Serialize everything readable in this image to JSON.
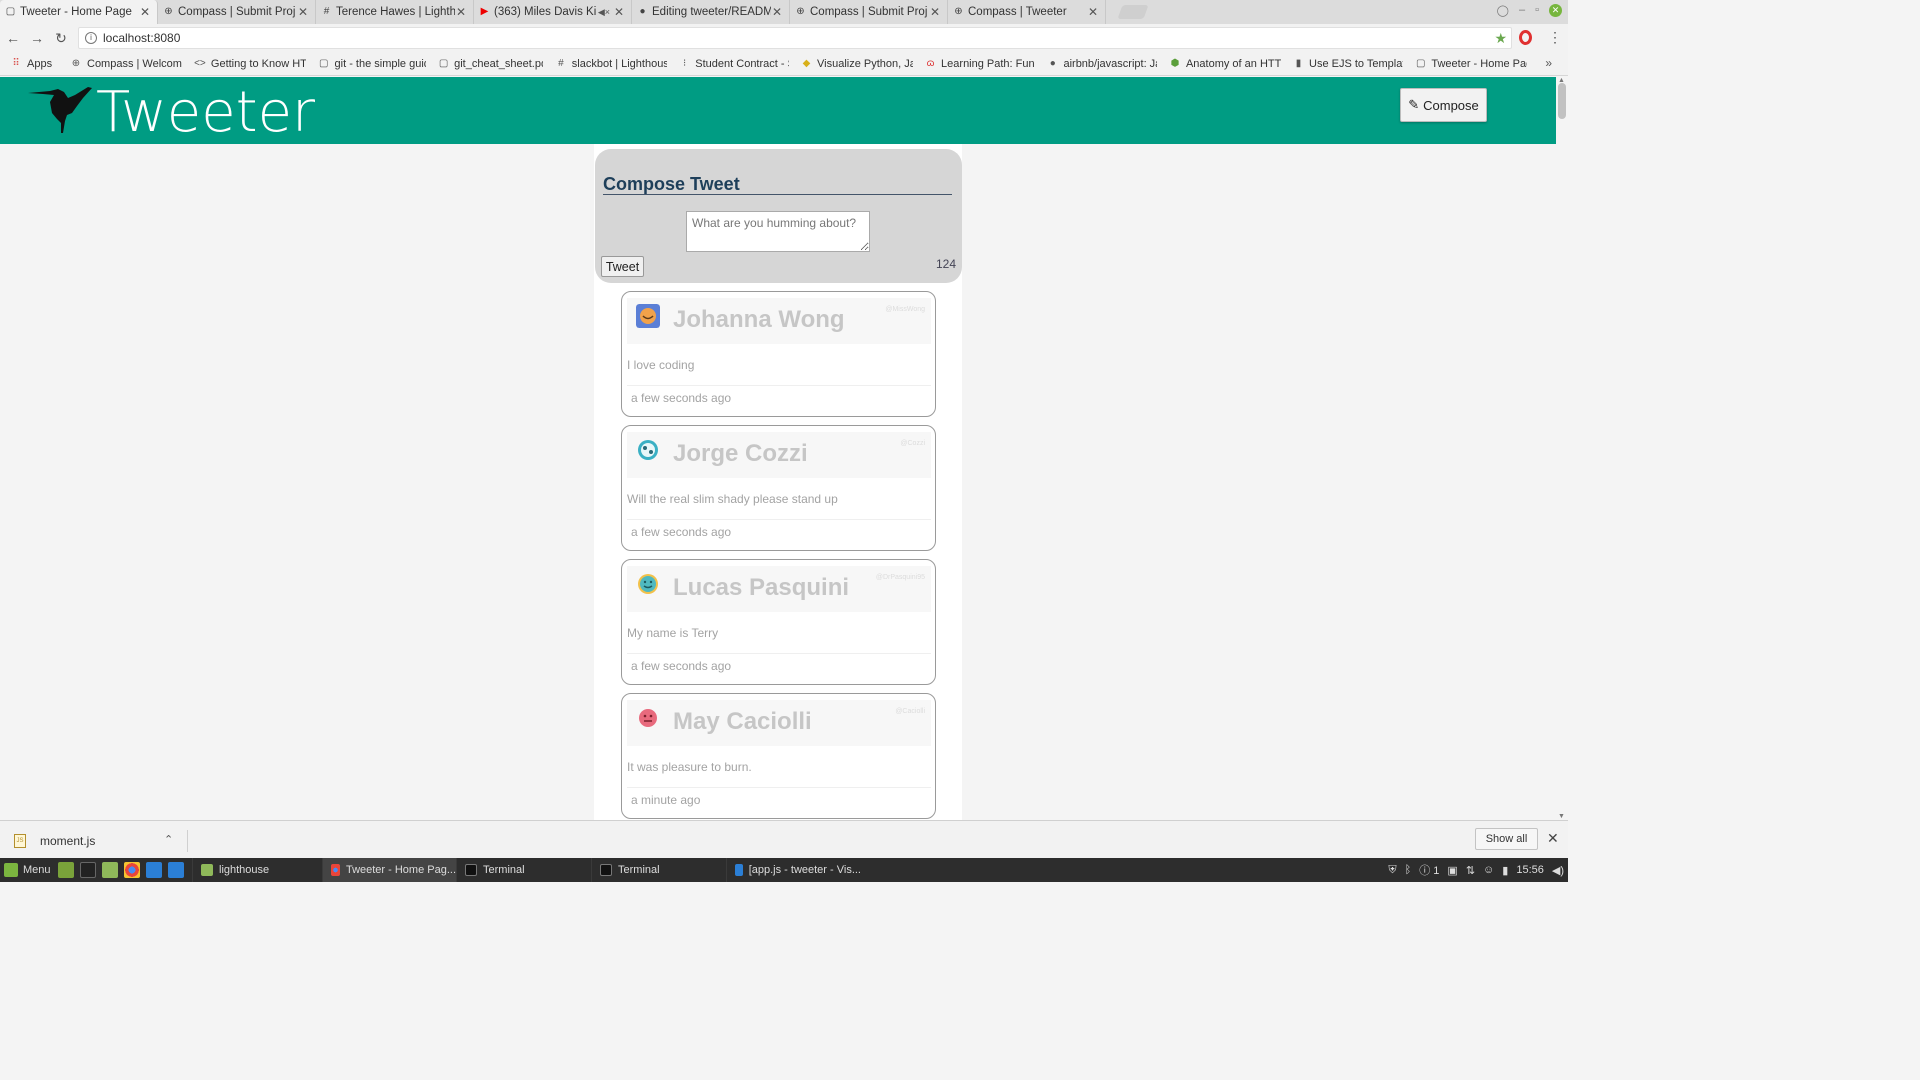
{
  "browser": {
    "tabs": [
      {
        "title": "Tweeter - Home Page",
        "icon": "page-icon",
        "active": true
      },
      {
        "title": "Compass | Submit Proj",
        "icon": "compass-icon"
      },
      {
        "title": "Terence Hawes | Lighth",
        "icon": "slack-icon"
      },
      {
        "title": "(363) Miles Davis Ki",
        "icon": "youtube-icon",
        "muted": true
      },
      {
        "title": "Editing tweeter/READM",
        "icon": "github-icon"
      },
      {
        "title": "Compass | Submit Proj",
        "icon": "compass-icon"
      },
      {
        "title": "Compass | Tweeter",
        "icon": "compass-icon"
      }
    ],
    "url": "localhost:8080",
    "bookmarks": [
      {
        "label": "Apps",
        "icon": "apps-grid-icon"
      },
      {
        "label": "Compass | Welcom",
        "icon": "compass-icon"
      },
      {
        "label": "Getting to Know HT",
        "icon": "code-icon"
      },
      {
        "label": "git - the simple guid",
        "icon": "page-icon"
      },
      {
        "label": "git_cheat_sheet.pdf",
        "icon": "page-icon"
      },
      {
        "label": "slackbot | Lighthous",
        "icon": "slack-icon"
      },
      {
        "label": "Student Contract - S",
        "icon": "doc-icon"
      },
      {
        "label": "Visualize Python, Jav",
        "icon": "python-icon"
      },
      {
        "label": "Learning Path: Funct",
        "icon": "pdf-icon"
      },
      {
        "label": "airbnb/javascript: Ja",
        "icon": "github-icon"
      },
      {
        "label": "Anatomy of an HTT",
        "icon": "node-icon"
      },
      {
        "label": "Use EJS to Template",
        "icon": "bookmark-icon"
      },
      {
        "label": "Tweeter - Home Pag",
        "icon": "page-icon"
      }
    ]
  },
  "app": {
    "brand": "Tweeter",
    "compose_label": "Compose",
    "header_color": "#009c83",
    "compose": {
      "title": "Compose Tweet",
      "placeholder": "What are you humming about?",
      "tweet_label": "Tweet",
      "counter": "124"
    },
    "tweets": [
      {
        "name": "Johanna Wong",
        "handle": "@MissWong",
        "text": "I love coding",
        "time": "a few seconds ago",
        "avatar_color": "#5b7fd6"
      },
      {
        "name": "Jorge Cozzi",
        "handle": "@Cozzi",
        "text": "Will the real slim shady please stand up",
        "time": "a few seconds ago",
        "avatar_color": "#3ab0c4"
      },
      {
        "name": "Lucas Pasquini",
        "handle": "@DrPasquini95",
        "text": "My name is Terry",
        "time": "a few seconds ago",
        "avatar_color": "#4fb9c0"
      },
      {
        "name": "May Caciolli",
        "handle": "@Caciolli",
        "text": "It was pleasure to burn.",
        "time": "a minute ago",
        "avatar_color": "#e86a7d"
      }
    ]
  },
  "downloads": {
    "file": "moment.js",
    "show_all": "Show all"
  },
  "taskbar": {
    "menu": "Menu",
    "tasks": [
      {
        "label": "lighthouse",
        "icon": "folder-icon"
      },
      {
        "label": "Tweeter - Home Pag...",
        "icon": "chrome-icon",
        "active": true
      },
      {
        "label": "Terminal",
        "icon": "terminal-icon"
      },
      {
        "label": "Terminal",
        "icon": "terminal-icon"
      },
      {
        "label": "[app.js - tweeter - Vis...",
        "icon": "vscode-icon"
      }
    ],
    "clock": "15:56",
    "tray_count": "1"
  }
}
